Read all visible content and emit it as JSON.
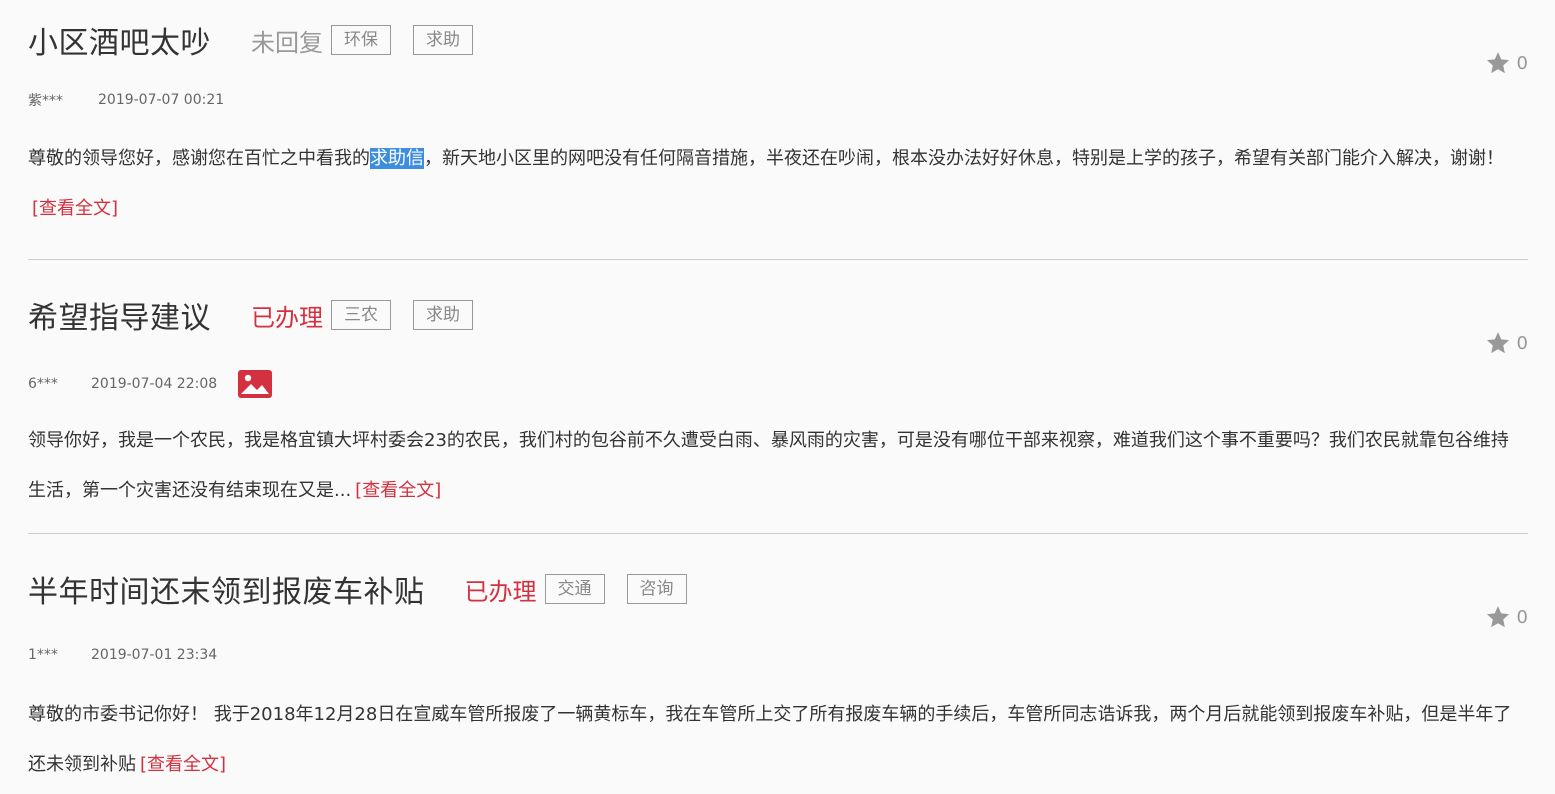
{
  "posts": [
    {
      "title": "小区酒吧太吵",
      "status": "未回复",
      "status_type": "pending",
      "tags": [
        "环保",
        "求助"
      ],
      "user": "紫***",
      "time": "2019-07-07 00:21",
      "has_image": false,
      "likes": "0",
      "content_before": "尊敬的领导您好，感谢您在百忙之中看我的",
      "content_highlight": "求助信",
      "content_after": "，新天地小区里的网吧没有任何隔音措施，半夜还在吵闹，根本没办法好好休息，特别是上学的孩子，希望有关部门能介入解决，谢谢！",
      "more": "[查看全文]"
    },
    {
      "title": "希望指导建议",
      "status": "已办理",
      "status_type": "done",
      "tags": [
        "三农",
        "求助"
      ],
      "user": "6***",
      "time": "2019-07-04 22:08",
      "has_image": true,
      "likes": "0",
      "content_before": "领导你好，我是一个农民，我是格宜镇大坪村委会23的农民，我们村的包谷前不久遭受白雨、暴风雨的灾害，可是没有哪位干部来视察，难道我们这个事不重要吗？我们农民就靠包谷维持生活，第一个灾害还没有结束现在又是...",
      "content_highlight": "",
      "content_after": "",
      "more": "[查看全文]"
    },
    {
      "title": "半年时间还末领到报废车补贴",
      "status": "已办理",
      "status_type": "done",
      "tags": [
        "交通",
        "咨询"
      ],
      "user": "1***",
      "time": "2019-07-01 23:34",
      "has_image": false,
      "likes": "0",
      "content_before": "尊敬的市委书记你好！ 我于2018年12月28日在宣威车管所报废了一辆黄标车，我在车管所上交了所有报废车辆的手续后，车管所同志诰诉我，两个月后就能领到报废车补贴，但是半年了还未领到补贴",
      "content_highlight": "",
      "content_after": "",
      "more": "[查看全文]"
    }
  ]
}
